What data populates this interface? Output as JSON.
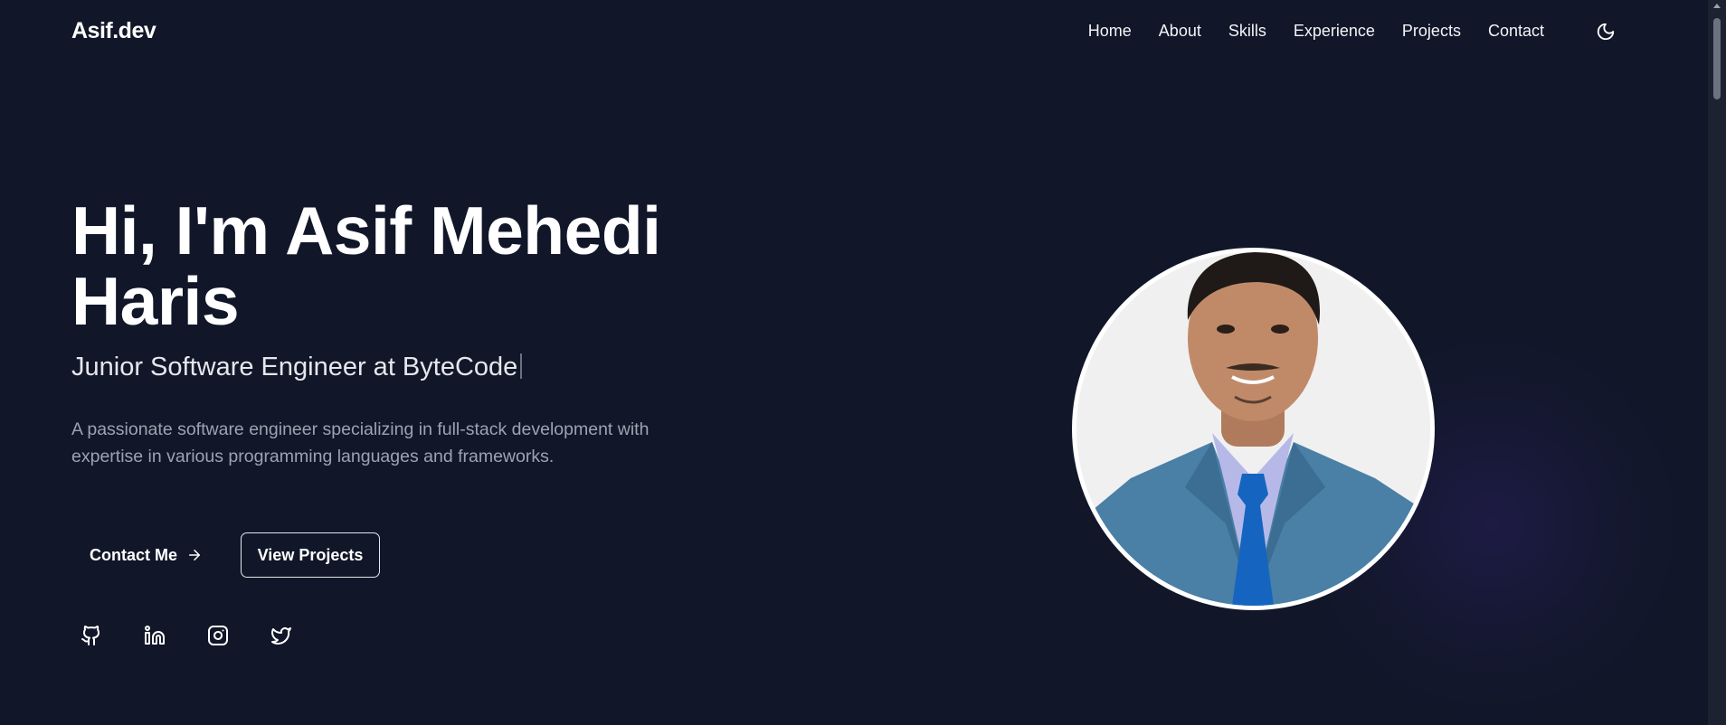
{
  "nav": {
    "logo": "Asif.dev",
    "links": [
      "Home",
      "About",
      "Skills",
      "Experience",
      "Projects",
      "Contact"
    ],
    "theme_icon": "moon-icon"
  },
  "hero": {
    "title": "Hi, I'm Asif Mehedi Haris",
    "subtitle": "Junior Software Engineer at ByteCode",
    "description": "A passionate software engineer specializing in full-stack development with expertise in various programming languages and frameworks.",
    "contact_button": "Contact Me",
    "contact_icon": "arrow-right-icon",
    "projects_button": "View Projects",
    "socials": [
      "github-icon",
      "linkedin-icon",
      "instagram-icon",
      "twitter-icon"
    ]
  },
  "colors": {
    "background": "#111729",
    "text": "#ffffff",
    "muted": "#9ca3af",
    "portrait_border": "#ffffff",
    "suit": "#4a7fa6",
    "tie": "#1565c0"
  }
}
